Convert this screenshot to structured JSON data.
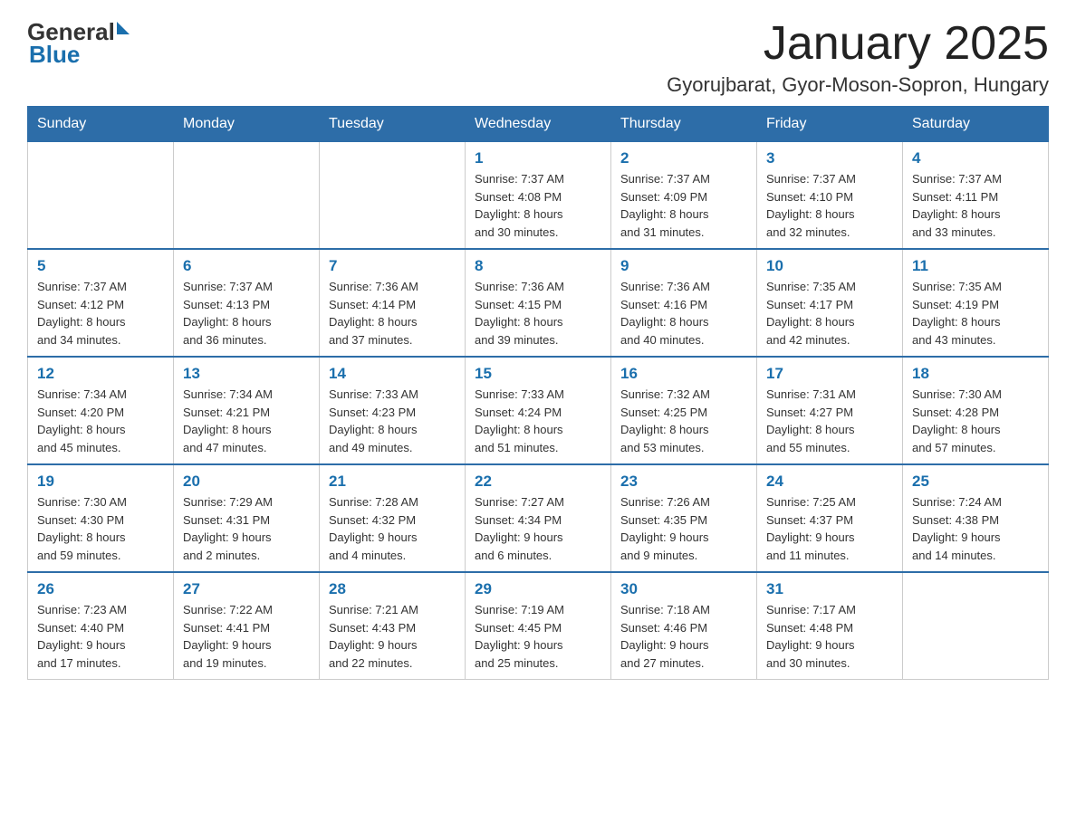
{
  "header": {
    "logo_general": "General",
    "logo_blue": "Blue",
    "month_title": "January 2025",
    "location": "Gyorujbarat, Gyor-Moson-Sopron, Hungary"
  },
  "days_of_week": [
    "Sunday",
    "Monday",
    "Tuesday",
    "Wednesday",
    "Thursday",
    "Friday",
    "Saturday"
  ],
  "weeks": [
    [
      {
        "day": "",
        "info": ""
      },
      {
        "day": "",
        "info": ""
      },
      {
        "day": "",
        "info": ""
      },
      {
        "day": "1",
        "info": "Sunrise: 7:37 AM\nSunset: 4:08 PM\nDaylight: 8 hours\nand 30 minutes."
      },
      {
        "day": "2",
        "info": "Sunrise: 7:37 AM\nSunset: 4:09 PM\nDaylight: 8 hours\nand 31 minutes."
      },
      {
        "day": "3",
        "info": "Sunrise: 7:37 AM\nSunset: 4:10 PM\nDaylight: 8 hours\nand 32 minutes."
      },
      {
        "day": "4",
        "info": "Sunrise: 7:37 AM\nSunset: 4:11 PM\nDaylight: 8 hours\nand 33 minutes."
      }
    ],
    [
      {
        "day": "5",
        "info": "Sunrise: 7:37 AM\nSunset: 4:12 PM\nDaylight: 8 hours\nand 34 minutes."
      },
      {
        "day": "6",
        "info": "Sunrise: 7:37 AM\nSunset: 4:13 PM\nDaylight: 8 hours\nand 36 minutes."
      },
      {
        "day": "7",
        "info": "Sunrise: 7:36 AM\nSunset: 4:14 PM\nDaylight: 8 hours\nand 37 minutes."
      },
      {
        "day": "8",
        "info": "Sunrise: 7:36 AM\nSunset: 4:15 PM\nDaylight: 8 hours\nand 39 minutes."
      },
      {
        "day": "9",
        "info": "Sunrise: 7:36 AM\nSunset: 4:16 PM\nDaylight: 8 hours\nand 40 minutes."
      },
      {
        "day": "10",
        "info": "Sunrise: 7:35 AM\nSunset: 4:17 PM\nDaylight: 8 hours\nand 42 minutes."
      },
      {
        "day": "11",
        "info": "Sunrise: 7:35 AM\nSunset: 4:19 PM\nDaylight: 8 hours\nand 43 minutes."
      }
    ],
    [
      {
        "day": "12",
        "info": "Sunrise: 7:34 AM\nSunset: 4:20 PM\nDaylight: 8 hours\nand 45 minutes."
      },
      {
        "day": "13",
        "info": "Sunrise: 7:34 AM\nSunset: 4:21 PM\nDaylight: 8 hours\nand 47 minutes."
      },
      {
        "day": "14",
        "info": "Sunrise: 7:33 AM\nSunset: 4:23 PM\nDaylight: 8 hours\nand 49 minutes."
      },
      {
        "day": "15",
        "info": "Sunrise: 7:33 AM\nSunset: 4:24 PM\nDaylight: 8 hours\nand 51 minutes."
      },
      {
        "day": "16",
        "info": "Sunrise: 7:32 AM\nSunset: 4:25 PM\nDaylight: 8 hours\nand 53 minutes."
      },
      {
        "day": "17",
        "info": "Sunrise: 7:31 AM\nSunset: 4:27 PM\nDaylight: 8 hours\nand 55 minutes."
      },
      {
        "day": "18",
        "info": "Sunrise: 7:30 AM\nSunset: 4:28 PM\nDaylight: 8 hours\nand 57 minutes."
      }
    ],
    [
      {
        "day": "19",
        "info": "Sunrise: 7:30 AM\nSunset: 4:30 PM\nDaylight: 8 hours\nand 59 minutes."
      },
      {
        "day": "20",
        "info": "Sunrise: 7:29 AM\nSunset: 4:31 PM\nDaylight: 9 hours\nand 2 minutes."
      },
      {
        "day": "21",
        "info": "Sunrise: 7:28 AM\nSunset: 4:32 PM\nDaylight: 9 hours\nand 4 minutes."
      },
      {
        "day": "22",
        "info": "Sunrise: 7:27 AM\nSunset: 4:34 PM\nDaylight: 9 hours\nand 6 minutes."
      },
      {
        "day": "23",
        "info": "Sunrise: 7:26 AM\nSunset: 4:35 PM\nDaylight: 9 hours\nand 9 minutes."
      },
      {
        "day": "24",
        "info": "Sunrise: 7:25 AM\nSunset: 4:37 PM\nDaylight: 9 hours\nand 11 minutes."
      },
      {
        "day": "25",
        "info": "Sunrise: 7:24 AM\nSunset: 4:38 PM\nDaylight: 9 hours\nand 14 minutes."
      }
    ],
    [
      {
        "day": "26",
        "info": "Sunrise: 7:23 AM\nSunset: 4:40 PM\nDaylight: 9 hours\nand 17 minutes."
      },
      {
        "day": "27",
        "info": "Sunrise: 7:22 AM\nSunset: 4:41 PM\nDaylight: 9 hours\nand 19 minutes."
      },
      {
        "day": "28",
        "info": "Sunrise: 7:21 AM\nSunset: 4:43 PM\nDaylight: 9 hours\nand 22 minutes."
      },
      {
        "day": "29",
        "info": "Sunrise: 7:19 AM\nSunset: 4:45 PM\nDaylight: 9 hours\nand 25 minutes."
      },
      {
        "day": "30",
        "info": "Sunrise: 7:18 AM\nSunset: 4:46 PM\nDaylight: 9 hours\nand 27 minutes."
      },
      {
        "day": "31",
        "info": "Sunrise: 7:17 AM\nSunset: 4:48 PM\nDaylight: 9 hours\nand 30 minutes."
      },
      {
        "day": "",
        "info": ""
      }
    ]
  ]
}
